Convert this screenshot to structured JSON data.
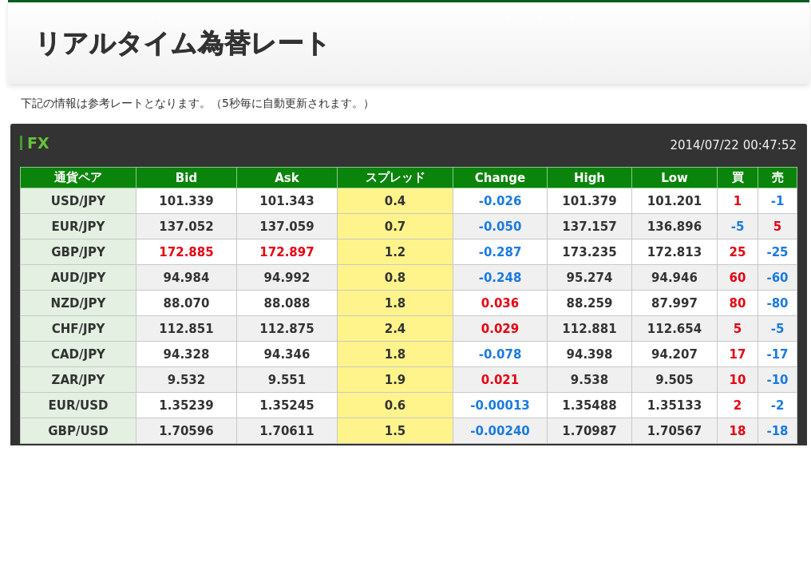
{
  "page_title": "リアルタイム為替レート",
  "note": "下記の情報は参考レートとなります。（5秒毎に自動更新されます。）",
  "panel": {
    "title": "FX",
    "timestamp": "2014/07/22 00:47:52"
  },
  "table": {
    "columns": [
      {
        "label": "通貨ペア",
        "kind": "pair"
      },
      {
        "label": "Bid",
        "kind": "price"
      },
      {
        "label": "Ask",
        "kind": "price"
      },
      {
        "label": "スプレッド",
        "kind": "spread"
      },
      {
        "label": "Change",
        "kind": "price"
      },
      {
        "label": "High",
        "kind": "price"
      },
      {
        "label": "Low",
        "kind": "price"
      },
      {
        "label": "買",
        "kind": "price"
      },
      {
        "label": "売",
        "kind": "price"
      }
    ],
    "rows": [
      [
        {
          "value": "USD/JPY",
          "color": "#333333"
        },
        {
          "value": "101.339",
          "color": "#333333"
        },
        {
          "value": "101.343",
          "color": "#333333"
        },
        {
          "value": "0.4",
          "color": "#333333"
        },
        {
          "value": "-0.026",
          "color": "#1a7be0"
        },
        {
          "value": "101.379",
          "color": "#333333"
        },
        {
          "value": "101.201",
          "color": "#333333"
        },
        {
          "value": "1",
          "color": "#e60012"
        },
        {
          "value": "-1",
          "color": "#1a7be0"
        }
      ],
      [
        {
          "value": "EUR/JPY",
          "color": "#333333"
        },
        {
          "value": "137.052",
          "color": "#333333"
        },
        {
          "value": "137.059",
          "color": "#333333"
        },
        {
          "value": "0.7",
          "color": "#333333"
        },
        {
          "value": "-0.050",
          "color": "#1a7be0"
        },
        {
          "value": "137.157",
          "color": "#333333"
        },
        {
          "value": "136.896",
          "color": "#333333"
        },
        {
          "value": "-5",
          "color": "#1a7be0"
        },
        {
          "value": "5",
          "color": "#e60012"
        }
      ],
      [
        {
          "value": "GBP/JPY",
          "color": "#333333"
        },
        {
          "value": "172.885",
          "color": "#e60012"
        },
        {
          "value": "172.897",
          "color": "#e60012"
        },
        {
          "value": "1.2",
          "color": "#333333"
        },
        {
          "value": "-0.287",
          "color": "#1a7be0"
        },
        {
          "value": "173.235",
          "color": "#333333"
        },
        {
          "value": "172.813",
          "color": "#333333"
        },
        {
          "value": "25",
          "color": "#e60012"
        },
        {
          "value": "-25",
          "color": "#1a7be0"
        }
      ],
      [
        {
          "value": "AUD/JPY",
          "color": "#333333"
        },
        {
          "value": "94.984",
          "color": "#333333"
        },
        {
          "value": "94.992",
          "color": "#333333"
        },
        {
          "value": "0.8",
          "color": "#333333"
        },
        {
          "value": "-0.248",
          "color": "#1a7be0"
        },
        {
          "value": "95.274",
          "color": "#333333"
        },
        {
          "value": "94.946",
          "color": "#333333"
        },
        {
          "value": "60",
          "color": "#e60012"
        },
        {
          "value": "-60",
          "color": "#1a7be0"
        }
      ],
      [
        {
          "value": "NZD/JPY",
          "color": "#333333"
        },
        {
          "value": "88.070",
          "color": "#333333"
        },
        {
          "value": "88.088",
          "color": "#333333"
        },
        {
          "value": "1.8",
          "color": "#333333"
        },
        {
          "value": "0.036",
          "color": "#e60012"
        },
        {
          "value": "88.259",
          "color": "#333333"
        },
        {
          "value": "87.997",
          "color": "#333333"
        },
        {
          "value": "80",
          "color": "#e60012"
        },
        {
          "value": "-80",
          "color": "#1a7be0"
        }
      ],
      [
        {
          "value": "CHF/JPY",
          "color": "#333333"
        },
        {
          "value": "112.851",
          "color": "#333333"
        },
        {
          "value": "112.875",
          "color": "#333333"
        },
        {
          "value": "2.4",
          "color": "#333333"
        },
        {
          "value": "0.029",
          "color": "#e60012"
        },
        {
          "value": "112.881",
          "color": "#333333"
        },
        {
          "value": "112.654",
          "color": "#333333"
        },
        {
          "value": "5",
          "color": "#e60012"
        },
        {
          "value": "-5",
          "color": "#1a7be0"
        }
      ],
      [
        {
          "value": "CAD/JPY",
          "color": "#333333"
        },
        {
          "value": "94.328",
          "color": "#333333"
        },
        {
          "value": "94.346",
          "color": "#333333"
        },
        {
          "value": "1.8",
          "color": "#333333"
        },
        {
          "value": "-0.078",
          "color": "#1a7be0"
        },
        {
          "value": "94.398",
          "color": "#333333"
        },
        {
          "value": "94.207",
          "color": "#333333"
        },
        {
          "value": "17",
          "color": "#e60012"
        },
        {
          "value": "-17",
          "color": "#1a7be0"
        }
      ],
      [
        {
          "value": "ZAR/JPY",
          "color": "#333333"
        },
        {
          "value": "9.532",
          "color": "#333333"
        },
        {
          "value": "9.551",
          "color": "#333333"
        },
        {
          "value": "1.9",
          "color": "#333333"
        },
        {
          "value": "0.021",
          "color": "#e60012"
        },
        {
          "value": "9.538",
          "color": "#333333"
        },
        {
          "value": "9.505",
          "color": "#333333"
        },
        {
          "value": "10",
          "color": "#e60012"
        },
        {
          "value": "-10",
          "color": "#1a7be0"
        }
      ],
      [
        {
          "value": "EUR/USD",
          "color": "#333333"
        },
        {
          "value": "1.35239",
          "color": "#333333"
        },
        {
          "value": "1.35245",
          "color": "#333333"
        },
        {
          "value": "0.6",
          "color": "#333333"
        },
        {
          "value": "-0.00013",
          "color": "#1a7be0"
        },
        {
          "value": "1.35488",
          "color": "#333333"
        },
        {
          "value": "1.35133",
          "color": "#333333"
        },
        {
          "value": "2",
          "color": "#e60012"
        },
        {
          "value": "-2",
          "color": "#1a7be0"
        }
      ],
      [
        {
          "value": "GBP/USD",
          "color": "#333333"
        },
        {
          "value": "1.70596",
          "color": "#333333"
        },
        {
          "value": "1.70611",
          "color": "#333333"
        },
        {
          "value": "1.5",
          "color": "#333333"
        },
        {
          "value": "-0.00240",
          "color": "#1a7be0"
        },
        {
          "value": "1.70987",
          "color": "#333333"
        },
        {
          "value": "1.70567",
          "color": "#333333"
        },
        {
          "value": "18",
          "color": "#e60012"
        },
        {
          "value": "-18",
          "color": "#1a7be0"
        }
      ]
    ]
  }
}
